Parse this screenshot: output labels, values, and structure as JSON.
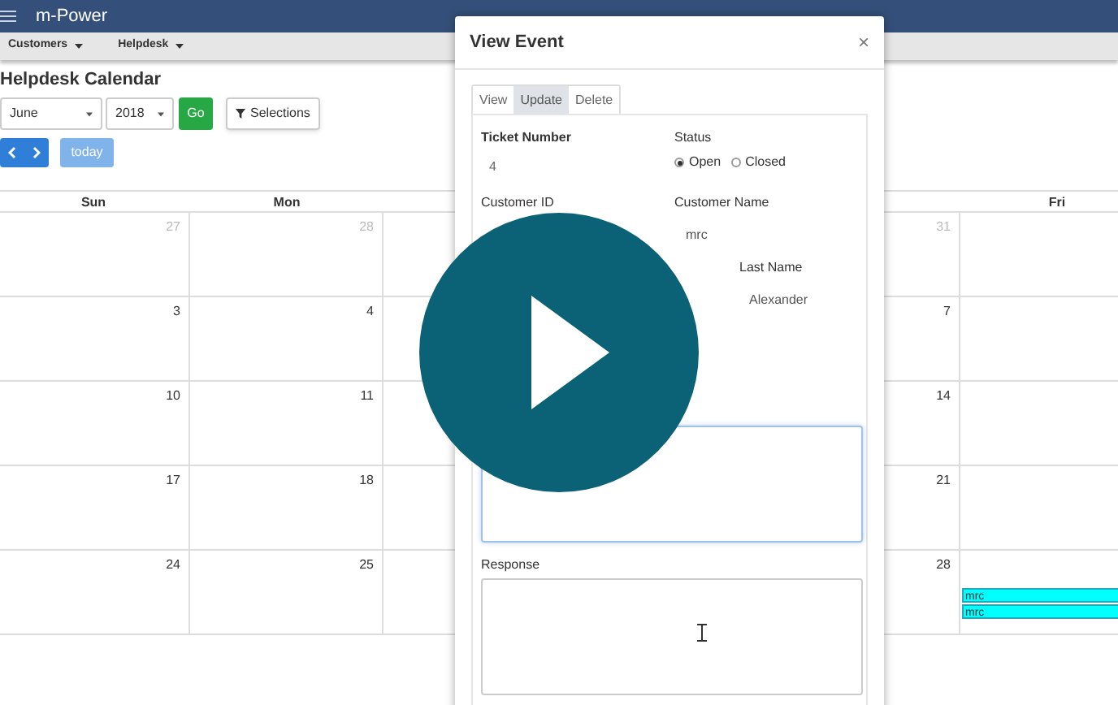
{
  "app": {
    "title": "m-Power"
  },
  "menu": [
    {
      "label": "Customers"
    },
    {
      "label": "Helpdesk"
    }
  ],
  "page": {
    "title": "Helpdesk Calendar",
    "month_select": {
      "value": "June"
    },
    "year_select": {
      "value": "2018"
    },
    "go_button": "Go",
    "selections_button": "Selections",
    "today_button": "today"
  },
  "calendar": {
    "columns": [
      {
        "label": "Sun"
      },
      {
        "label": "Mon"
      },
      {},
      {},
      {},
      {
        "label": "Fri"
      }
    ],
    "weeks": [
      {
        "days": [
          {
            "kind": "sun",
            "number": "27",
            "other_month": true
          },
          {
            "kind": "mon",
            "number": "28",
            "other_month": true
          },
          {
            "kind": "thu",
            "number": "31",
            "other_month": true
          }
        ]
      },
      {
        "days": [
          {
            "kind": "sun",
            "number": "3",
            "other_month": false
          },
          {
            "kind": "mon",
            "number": "4",
            "other_month": false
          },
          {
            "kind": "thu",
            "number": "7",
            "other_month": false
          }
        ]
      },
      {
        "days": [
          {
            "kind": "sun",
            "number": "10",
            "other_month": false
          },
          {
            "kind": "mon",
            "number": "11",
            "other_month": false
          },
          {
            "kind": "thu",
            "number": "14",
            "other_month": false
          }
        ]
      },
      {
        "days": [
          {
            "kind": "sun",
            "number": "17",
            "other_month": false
          },
          {
            "kind": "mon",
            "number": "18",
            "other_month": false
          },
          {
            "kind": "thu",
            "number": "21",
            "other_month": false
          }
        ]
      },
      {
        "days": [
          {
            "kind": "sun",
            "number": "24",
            "other_month": false
          },
          {
            "kind": "mon",
            "number": "25",
            "other_month": false
          },
          {
            "kind": "thu",
            "number": "28",
            "other_month": false
          },
          {
            "kind": "fri",
            "events": [
              {
                "label": "mrc",
                "color": "#00ffff"
              },
              {
                "label": "mrc",
                "color": "#00ffff"
              }
            ]
          }
        ]
      }
    ]
  },
  "modal": {
    "title": "View Event",
    "close": "×",
    "tabs": [
      {
        "label": "View",
        "selected": false
      },
      {
        "label": "Update",
        "selected": true
      },
      {
        "label": "Delete",
        "selected": false
      }
    ],
    "ticket_number": {
      "label": "Ticket Number",
      "value": "4"
    },
    "status": {
      "label": "Status",
      "options": [
        {
          "label": "Open",
          "selected": true
        },
        {
          "label": "Closed",
          "selected": false
        }
      ]
    },
    "customer_id": {
      "label": "Customer ID"
    },
    "customer_name": {
      "label": "Customer Name",
      "value": "mrc"
    },
    "last_name": {
      "label": "Last Name",
      "value": "Alexander"
    },
    "response": {
      "label": "Response"
    }
  }
}
